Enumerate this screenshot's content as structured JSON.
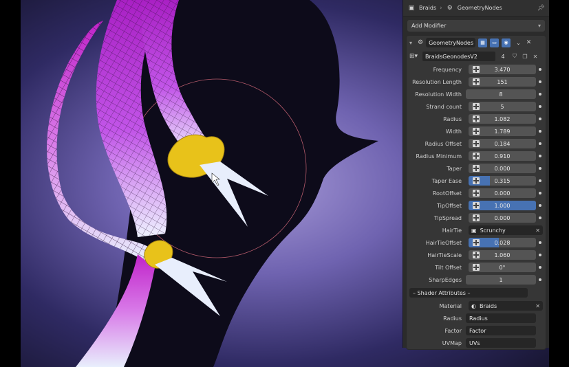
{
  "header": {
    "object_name": "Braids",
    "separator": "›",
    "modifier_name": "GeometryNodes"
  },
  "add_modifier": {
    "label": "Add Modifier"
  },
  "modifier": {
    "name": "GeometryNodes",
    "node_group": "BraidsGeonodesV2",
    "users": "4"
  },
  "params": [
    {
      "label": "Frequency",
      "value": "3.470",
      "socket": true,
      "fill": 0
    },
    {
      "label": "Resolution Length",
      "value": "151",
      "socket": true,
      "fill": 0
    },
    {
      "label": "Resolution Width",
      "value": "8",
      "socket": false,
      "fill": 0
    },
    {
      "label": "Strand count",
      "value": "5",
      "socket": true,
      "fill": 0
    },
    {
      "label": "Radius",
      "value": "1.082",
      "socket": true,
      "fill": 0
    },
    {
      "label": "Width",
      "value": "1.789",
      "socket": true,
      "fill": 0
    },
    {
      "label": "Radius Offset",
      "value": "0.184",
      "socket": true,
      "fill": 0
    },
    {
      "label": "Radius Minimum",
      "value": "0.910",
      "socket": true,
      "fill": 0
    },
    {
      "label": "Taper",
      "value": "0.000",
      "socket": true,
      "fill": 0
    },
    {
      "label": "Taper Ease",
      "value": "0.315",
      "socket": true,
      "fill": 0.315
    },
    {
      "label": "RootOffset",
      "value": "0.000",
      "socket": true,
      "fill": 0
    },
    {
      "label": "TipOffset",
      "value": "1.000",
      "socket": true,
      "fill": 1.0
    },
    {
      "label": "TipSpread",
      "value": "0.000",
      "socket": true,
      "fill": 0
    }
  ],
  "hairtie": {
    "label": "HairTie",
    "value": "Scrunchy"
  },
  "params2": [
    {
      "label": "HairTieOffset",
      "value": "0.028",
      "socket": true,
      "fill": 0.45
    },
    {
      "label": "HairTieScale",
      "value": "1.060",
      "socket": true,
      "fill": 0
    },
    {
      "label": "Tilt Offset",
      "value": "0°",
      "socket": true,
      "fill": 0
    },
    {
      "label": "SharpEdges",
      "value": "1",
      "socket": false,
      "fill": 0
    }
  ],
  "shader_section": {
    "label": "– Shader Attributes –"
  },
  "material": {
    "label": "Material",
    "value": "Braids"
  },
  "attrs": [
    {
      "label": "Radius",
      "value": "Radius"
    },
    {
      "label": "Factor",
      "value": "Factor"
    },
    {
      "label": "UVMap",
      "value": "UVs"
    }
  ],
  "colors": {
    "accent": "#4772b3",
    "panel_bg": "#2b2b2b",
    "field_bg": "#545454",
    "braid_pink": "#d54be0",
    "braid_white": "#e8eefc",
    "hairtie_yellow": "#e8c21a"
  }
}
